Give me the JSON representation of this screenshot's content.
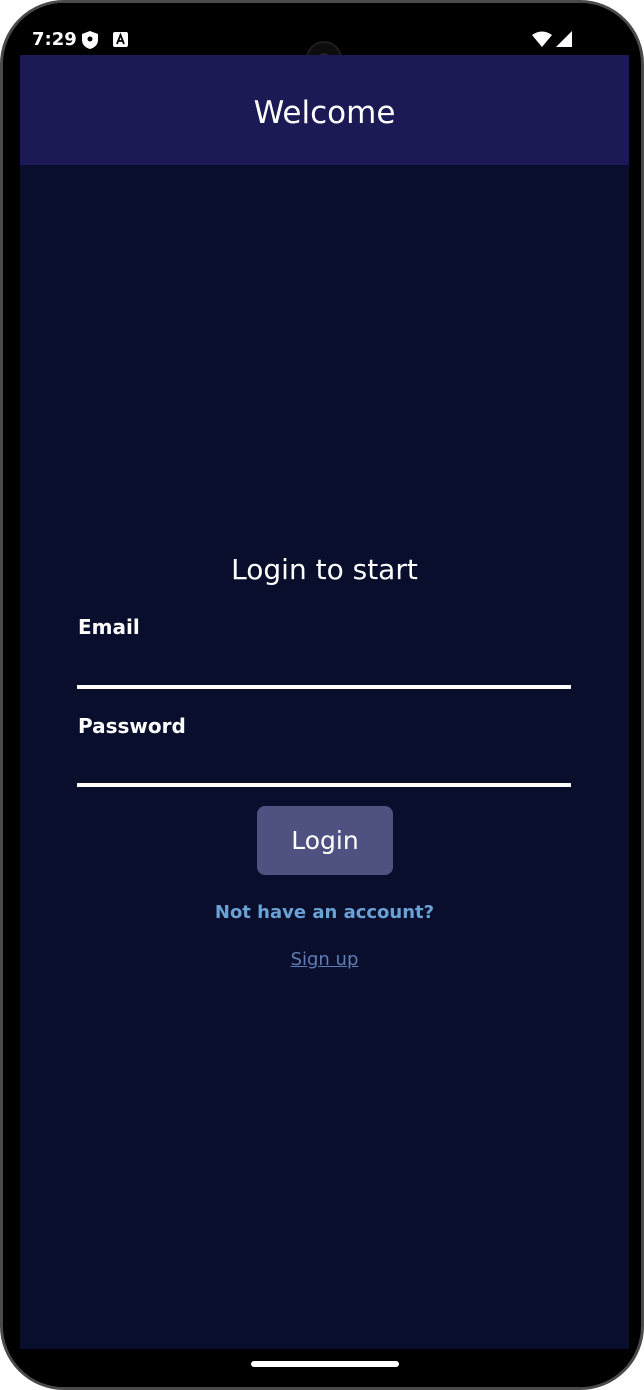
{
  "status_bar": {
    "time": "7:29",
    "icons": [
      "shield-icon",
      "a-notification-icon",
      "wifi-icon",
      "signal-icon"
    ]
  },
  "app_bar": {
    "title": "Welcome"
  },
  "login": {
    "heading": "Login to start",
    "email_label": "Email",
    "email_value": "",
    "password_label": "Password",
    "password_value": "",
    "login_button": "Login",
    "prompt": "Not have an account?",
    "signup_link": "Sign up"
  },
  "colors": {
    "app_bar_bg": "#1c1a55",
    "content_bg": "#080e2b",
    "button_bg": "#4f5181",
    "prompt_text": "#6aa2d6",
    "link_text": "#5f7cb5"
  }
}
